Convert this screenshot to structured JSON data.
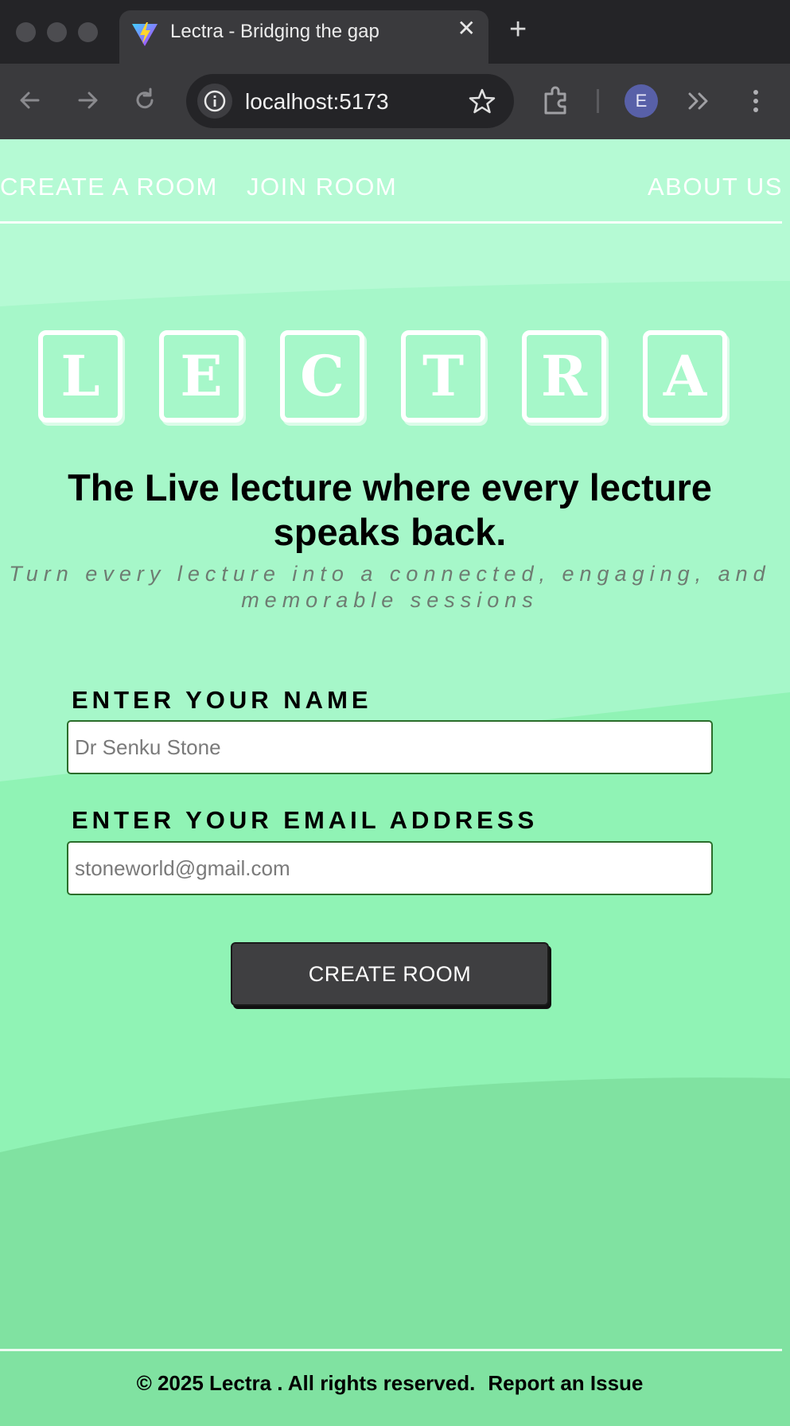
{
  "browser": {
    "tab_title": "Lectra - Bridging the gap",
    "url": "localhost:5173",
    "profile_initial": "E",
    "favicon": "vite-logo-icon"
  },
  "nav": {
    "create_room": "CREATE A ROOM",
    "join_room": "JOIN ROOM",
    "about_us": "ABOUT US"
  },
  "logo": {
    "letters": [
      "L",
      "E",
      "C",
      "T",
      "R",
      "A"
    ]
  },
  "hero": {
    "headline": "The Live lecture where every lecture speaks back.",
    "subline": "Turn every lecture into a connected, engaging, and memorable sessions"
  },
  "form": {
    "name_label": "ENTER YOUR NAME",
    "name_placeholder": "Dr Senku Stone",
    "email_label": "ENTER YOUR EMAIL ADDRESS",
    "email_placeholder": "stoneworld@gmail.com",
    "submit_label": "CREATE ROOM"
  },
  "footer": {
    "copyright": "© 2025 Lectra . All rights reserved.",
    "report": "Report an Issue"
  },
  "colors": {
    "page_bg": "#a6f7c9",
    "button_bg": "#3f3f41",
    "input_border": "#2b6d2b"
  }
}
